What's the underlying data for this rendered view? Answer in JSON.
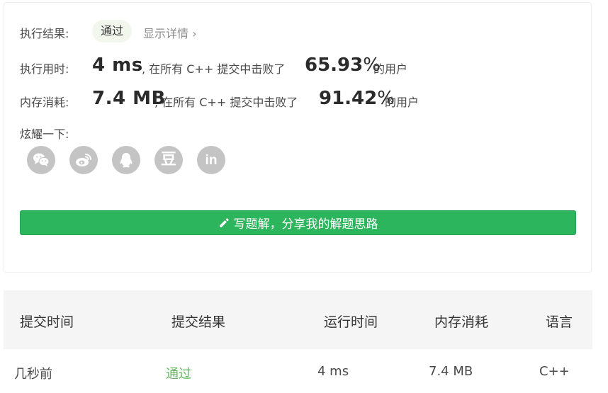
{
  "result": {
    "label": "执行结果:",
    "status": "通过",
    "details_link": "显示详情 ›"
  },
  "runtime": {
    "label": "执行用时:",
    "value": "4 ms",
    "text": ", 在所有 C++ 提交中击败了",
    "percent_number": "65.93",
    "percent_sign": "%",
    "suffix": "的用户"
  },
  "memory": {
    "label": "内存消耗:",
    "value": "7.4 MB",
    "text": ", 在所有 C++ 提交中击败了",
    "percent_number": "91.42",
    "percent_sign": "%",
    "suffix": "的用户"
  },
  "share": {
    "label": "炫耀一下:",
    "icons": [
      "wechat-icon",
      "weibo-icon",
      "qq-icon",
      "douban-icon",
      "linkedin-icon"
    ],
    "douban_glyph": "豆",
    "linkedin_glyph": "in"
  },
  "solution_button": {
    "icon": "pencil-icon",
    "label": "写题解，分享我的解题思路"
  },
  "table": {
    "headers": [
      "提交时间",
      "提交结果",
      "运行时间",
      "内存消耗",
      "语言"
    ],
    "rows": [
      [
        "几秒前",
        "通过",
        "4 ms",
        "7.4 MB",
        "C++"
      ]
    ]
  },
  "colors": {
    "accent_green": "#2db55d",
    "pass_green": "#5cb85c",
    "icon_gray": "#c4c4c4",
    "pill_bg": "#f2f7ee",
    "header_bg": "#f5f5f5"
  }
}
